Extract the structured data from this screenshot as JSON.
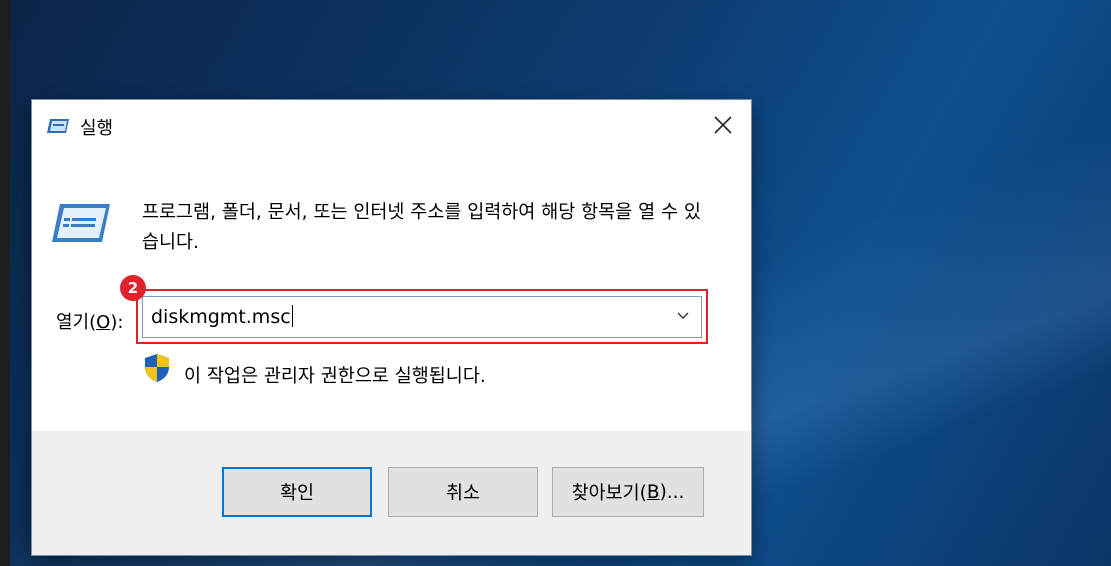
{
  "dialog": {
    "title": "실행",
    "description": "프로그램, 폴더, 문서, 또는 인터넷 주소를 입력하여 해당 항목을 열 수 있습니다.",
    "open_label_prefix": "열기(",
    "open_label_accel": "O",
    "open_label_suffix": "):",
    "input_value": "diskmgmt.msc",
    "admin_note": "이 작업은 관리자 권한으로 실행됩니다.",
    "buttons": {
      "ok": "확인",
      "cancel": "취소",
      "browse_prefix": "찾아보기(",
      "browse_accel": "B",
      "browse_suffix": ")..."
    }
  },
  "annotation": {
    "step_number": "2",
    "highlight_color": "#e0202a"
  },
  "icons": {
    "title": "run-icon",
    "body": "run-icon",
    "close": "close-icon",
    "dropdown": "chevron-down-icon",
    "uac": "uac-shield-icon"
  }
}
